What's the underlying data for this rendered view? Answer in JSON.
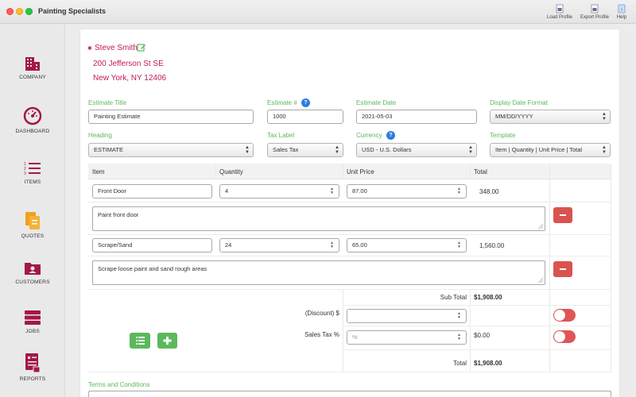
{
  "window": {
    "title": "Painting Specialists",
    "toolbar": {
      "load_profile": "Load Profile",
      "export_profile": "Export Profile",
      "help": "Help"
    }
  },
  "sidebar": {
    "items": [
      {
        "label": "COMPANY",
        "icon": "building-icon"
      },
      {
        "label": "DASHBOARD",
        "icon": "gauge-icon"
      },
      {
        "label": "ITEMS",
        "icon": "list-icon"
      },
      {
        "label": "QUOTES",
        "icon": "document-icon"
      },
      {
        "label": "CUSTOMERS",
        "icon": "contact-folder-icon"
      },
      {
        "label": "JOBS",
        "icon": "stack-icon"
      },
      {
        "label": "REPORTS",
        "icon": "report-icon"
      }
    ],
    "accent": "#a3174b"
  },
  "company": {
    "name": "Steve Smith",
    "address1": "200 Jefferson St SE",
    "address2": "New York, NY 12406"
  },
  "form": {
    "estimate_title_label": "Estimate Title",
    "estimate_title_value": "Painting Estimate",
    "estimate_no_label": "Estimate #",
    "estimate_no_value": "1000",
    "estimate_date_label": "Estimate Date",
    "estimate_date_value": "2021-05-03",
    "date_format_label": "Display Date Format",
    "date_format_value": "MM/DD/YYYY",
    "heading_label": "Heading",
    "heading_value": "ESTIMATE",
    "tax_label_label": "Tax Label",
    "tax_label_value": "Sales Tax",
    "currency_label": "Currency",
    "currency_value": "USD - U.S. Dollars",
    "template_label": "Template",
    "template_value": "Item | Quantity | Unit Price | Total"
  },
  "table": {
    "headers": {
      "item": "Item",
      "quantity": "Quantity",
      "unit_price": "Unit Price",
      "total": "Total"
    },
    "rows": [
      {
        "item": "Front Door",
        "quantity": "4",
        "unit_price": "87.00",
        "total": "348.00",
        "description": "Paint front door"
      },
      {
        "item": "Scrape/Sand",
        "quantity": "24",
        "unit_price": "65.00",
        "total": "1,560.00",
        "description": "Scrape loose paint and sand rough areas"
      }
    ]
  },
  "summary": {
    "subtotal_label": "Sub Total",
    "subtotal_value": "$1,908.00",
    "discount_label": "(Discount) $",
    "discount_value": "",
    "tax_label": "Sales Tax %",
    "tax_placeholder": "%",
    "tax_value": "$0.00",
    "total_label": "Total",
    "total_value": "$1,908.00"
  },
  "terms_label": "Terms and Conditions",
  "colors": {
    "accent_green": "#5cb85c",
    "danger_red": "#d9534f",
    "company_pink": "#c2185b",
    "help_blue": "#2a7de1"
  }
}
